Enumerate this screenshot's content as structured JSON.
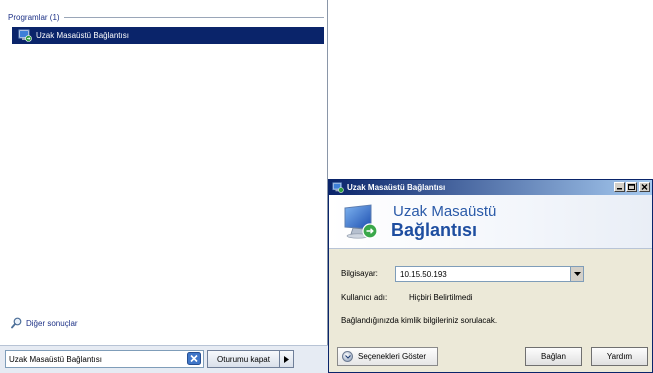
{
  "start_menu": {
    "programs_header": "Programlar (1)",
    "program_item_label": "Uzak Masaüstü Bağlantısı",
    "more_results_label": "Diğer sonuçlar",
    "search_value": "Uzak Masaüstü Bağlantısı",
    "shutdown_label": "Oturumu kapat"
  },
  "dialog": {
    "title": "Uzak Masaüstü Bağlantısı",
    "banner_line1": "Uzak Masaüstü",
    "banner_line2": "Bağlantısı",
    "computer_label": "Bilgisayar:",
    "computer_value": "10.15.50.193",
    "username_label": "Kullanıcı adı:",
    "username_value": "Hiçbiri Belirtilmedi",
    "credentials_note": "Bağlandığınızda kimlik bilgileriniz sorulacak.",
    "options_label": "Seçenekleri Göster",
    "connect_label": "Bağlan",
    "help_label": "Yardım"
  },
  "colors": {
    "selection": "#0a246a",
    "link_text": "#1e3287",
    "title_gradient_start": "#0a246a",
    "title_gradient_end": "#a6caf0",
    "dialog_face": "#ece9d8"
  }
}
